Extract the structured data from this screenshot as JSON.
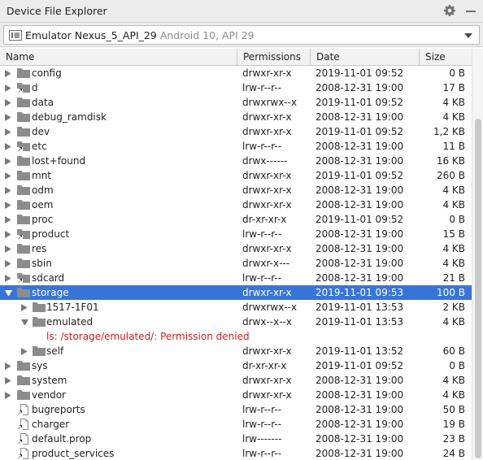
{
  "window": {
    "title": "Device File Explorer"
  },
  "device": {
    "name": "Emulator Nexus_5_API_29",
    "api": "Android 10, API 29"
  },
  "columns": {
    "name": "Name",
    "permissions": "Permissions",
    "date": "Date",
    "size": "Size"
  },
  "icons": {
    "settings": "gear-icon",
    "minimize": "minimize-icon",
    "device": "device-icon",
    "folder": "folder-icon",
    "link": "symlink-folder-icon",
    "file_link": "symlink-file-icon"
  },
  "colors": {
    "selection": "#3875d7",
    "error": "#d31c1c",
    "folder": "#8c8c8c"
  },
  "rows": [
    {
      "name": "config",
      "perm": "drwxr-xr-x",
      "date": "2019-11-01 09:52",
      "size": "0 B",
      "icon": "folder",
      "level": 0,
      "expander": "right"
    },
    {
      "name": "d",
      "perm": "lrw-r--r--",
      "date": "2008-12-31 19:00",
      "size": "17 B",
      "icon": "link",
      "level": 0,
      "expander": "right"
    },
    {
      "name": "data",
      "perm": "drwxrwx--x",
      "date": "2019-11-01 09:52",
      "size": "4 KB",
      "icon": "folder",
      "level": 0,
      "expander": "right"
    },
    {
      "name": "debug_ramdisk",
      "perm": "drwxr-xr-x",
      "date": "2008-12-31 19:00",
      "size": "4 KB",
      "icon": "folder",
      "level": 0,
      "expander": "right"
    },
    {
      "name": "dev",
      "perm": "drwxr-xr-x",
      "date": "2019-11-01 09:52",
      "size": "1,2 KB",
      "icon": "folder",
      "level": 0,
      "expander": "right"
    },
    {
      "name": "etc",
      "perm": "lrw-r--r--",
      "date": "2008-12-31 19:00",
      "size": "11 B",
      "icon": "link",
      "level": 0,
      "expander": "right"
    },
    {
      "name": "lost+found",
      "perm": "drwx------",
      "date": "2008-12-31 19:00",
      "size": "16 KB",
      "icon": "folder",
      "level": 0,
      "expander": "right"
    },
    {
      "name": "mnt",
      "perm": "drwxr-xr-x",
      "date": "2019-11-01 09:52",
      "size": "260 B",
      "icon": "folder",
      "level": 0,
      "expander": "right"
    },
    {
      "name": "odm",
      "perm": "drwxr-xr-x",
      "date": "2008-12-31 19:00",
      "size": "4 KB",
      "icon": "folder",
      "level": 0,
      "expander": "right"
    },
    {
      "name": "oem",
      "perm": "drwxr-xr-x",
      "date": "2008-12-31 19:00",
      "size": "4 KB",
      "icon": "folder",
      "level": 0,
      "expander": "right"
    },
    {
      "name": "proc",
      "perm": "dr-xr-xr-x",
      "date": "2019-11-01 09:52",
      "size": "0 B",
      "icon": "folder",
      "level": 0,
      "expander": "right"
    },
    {
      "name": "product",
      "perm": "lrw-r--r--",
      "date": "2008-12-31 19:00",
      "size": "15 B",
      "icon": "link",
      "level": 0,
      "expander": "right"
    },
    {
      "name": "res",
      "perm": "drwxr-xr-x",
      "date": "2008-12-31 19:00",
      "size": "4 KB",
      "icon": "folder",
      "level": 0,
      "expander": "right"
    },
    {
      "name": "sbin",
      "perm": "drwxr-x---",
      "date": "2008-12-31 19:00",
      "size": "4 KB",
      "icon": "folder",
      "level": 0,
      "expander": "right"
    },
    {
      "name": "sdcard",
      "perm": "lrw-r--r--",
      "date": "2008-12-31 19:00",
      "size": "21 B",
      "icon": "link",
      "level": 0,
      "expander": "right"
    },
    {
      "name": "storage",
      "perm": "drwxr-xr-x",
      "date": "2019-11-01 09:53",
      "size": "100 B",
      "icon": "folder",
      "level": 0,
      "expander": "down",
      "selected": true
    },
    {
      "name": "1517-1F01",
      "perm": "drwxrwx--x",
      "date": "2019-11-01 13:53",
      "size": "2 KB",
      "icon": "folder",
      "level": 1,
      "expander": "right"
    },
    {
      "name": "emulated",
      "perm": "drwx--x--x",
      "date": "2019-11-01 13:53",
      "size": "4 KB",
      "icon": "folder",
      "level": 1,
      "expander": "down"
    },
    {
      "error": "ls: /storage/emulated/: Permission denied"
    },
    {
      "name": "self",
      "perm": "drwxr-xr-x",
      "date": "2019-11-01 13:52",
      "size": "60 B",
      "icon": "folder",
      "level": 1,
      "expander": "right"
    },
    {
      "name": "sys",
      "perm": "dr-xr-xr-x",
      "date": "2019-11-01 09:52",
      "size": "0 B",
      "icon": "folder",
      "level": 0,
      "expander": "right"
    },
    {
      "name": "system",
      "perm": "drwxr-xr-x",
      "date": "2008-12-31 19:00",
      "size": "4 KB",
      "icon": "folder",
      "level": 0,
      "expander": "right"
    },
    {
      "name": "vendor",
      "perm": "drwxr-xr-x",
      "date": "2008-12-31 19:00",
      "size": "4 KB",
      "icon": "folder",
      "level": 0,
      "expander": "right"
    },
    {
      "name": "bugreports",
      "perm": "lrw-r--r--",
      "date": "2008-12-31 19:00",
      "size": "50 B",
      "icon": "file_link",
      "level": 0,
      "expander": "none"
    },
    {
      "name": "charger",
      "perm": "lrw-r--r--",
      "date": "2008-12-31 19:00",
      "size": "19 B",
      "icon": "file_link",
      "level": 0,
      "expander": "none"
    },
    {
      "name": "default.prop",
      "perm": "lrw-------",
      "date": "2008-12-31 19:00",
      "size": "23 B",
      "icon": "file_link",
      "level": 0,
      "expander": "none"
    },
    {
      "name": "product_services",
      "perm": "lrw-r--r--",
      "date": "2008-12-31 19:00",
      "size": "24 B",
      "icon": "file_link",
      "level": 0,
      "expander": "none"
    }
  ]
}
